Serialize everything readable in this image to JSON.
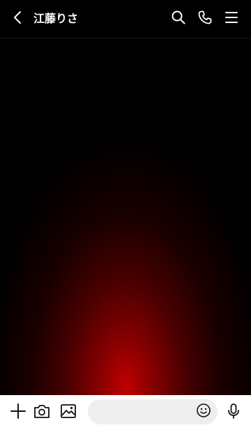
{
  "header": {
    "contact_name": "江藤りさ",
    "icons": [
      "back-chevron-icon",
      "search-icon",
      "phone-icon",
      "menu-icon"
    ]
  },
  "composer": {
    "message_value": "",
    "icons": [
      "plus-icon",
      "camera-icon",
      "image-icon",
      "emoji-icon",
      "microphone-icon"
    ]
  },
  "colors": {
    "header_bg": "#000000",
    "chat_bg": "#000000",
    "glow": "#c00000",
    "bottom_bar_bg": "#ffffff",
    "input_bg": "#eeeeee"
  }
}
